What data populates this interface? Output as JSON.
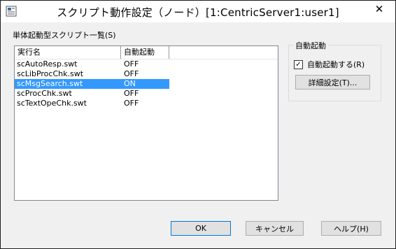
{
  "window": {
    "title": "スクリプト動作設定（ノード）[1:CentricServer1:user1]",
    "close_glyph": "✕"
  },
  "list": {
    "caption": "単体起動型スクリプト一覧(S)",
    "columns": [
      "実行名",
      "自動起動"
    ],
    "rows": [
      {
        "name": "scAutoResp.swt",
        "state": "OFF"
      },
      {
        "name": "scLibProcChk.swt",
        "state": "OFF"
      },
      {
        "name": "scMsgSearch.swt",
        "state": "ON"
      },
      {
        "name": "scProcChk.swt",
        "state": "OFF"
      },
      {
        "name": "scTextOpeChk.swt",
        "state": "OFF"
      }
    ],
    "selected_row": "scMsgSearch.swt"
  },
  "auto_start": {
    "group_label": "自動起動",
    "checkbox_label": "自動起動する(R)",
    "checkbox_checked": true,
    "check_glyph": "✓",
    "detail_button": "詳細設定(T)..."
  },
  "footer": {
    "ok": "OK",
    "cancel": "キャンセル",
    "help": "ヘルプ(H)"
  },
  "colors": {
    "selection": "#3399ff",
    "dialog_bg": "#f0f0f0"
  }
}
